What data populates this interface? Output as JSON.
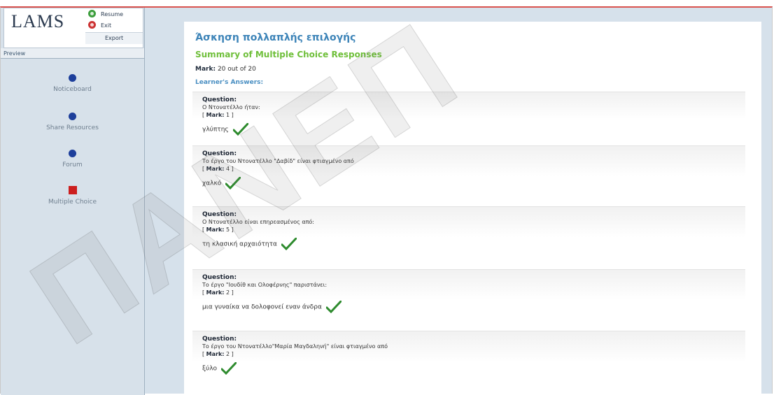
{
  "app": {
    "logo_text": "LAMS",
    "controls": {
      "resume": "Resume",
      "exit": "Exit",
      "export": "Export"
    },
    "preview_label": "Preview"
  },
  "sidebar": {
    "items": [
      {
        "label": "Noticeboard",
        "icon": "circle-icon",
        "color": "#1d3f9b"
      },
      {
        "label": "Share Resources",
        "icon": "circle-icon",
        "color": "#1d3f9b"
      },
      {
        "label": "Forum",
        "icon": "circle-icon",
        "color": "#1d3f9b"
      },
      {
        "label": "Multiple Choice",
        "icon": "square-icon",
        "color": "#cc1f1f"
      }
    ]
  },
  "main": {
    "title": "Άσκηση πολλαπλής επιλογής",
    "subtitle": "Summary of Multiple Choice Responses",
    "mark_label": "Mark:",
    "mark_value": "20 out of 20",
    "learner_heading": "Learner's Answers:",
    "question_label": "Question:",
    "mark_item_label": "Mark:",
    "questions": [
      {
        "text": "Ο Ντονατέλλο ήταν:",
        "mark": "1",
        "answer": "γλύπτης"
      },
      {
        "text": "Το έργο του Ντονατέλλο \"Δαβίδ\" είναι φτιαγμένο από",
        "mark": "4",
        "answer": "χαλκό"
      },
      {
        "text": "Ο Ντονατέλλο είναι επηρεασμένος από:",
        "mark": "5",
        "answer": "τη κλασική αρχαιότητα"
      },
      {
        "text": "Το έργο \"Ιουδίθ και Ολοφέρνης\" παριστάνει:",
        "mark": "2",
        "answer": "μια γυναίκα να δολοφονεί εναν άνδρα"
      },
      {
        "text": "Το έργο του Ντονατέλλο\"Μαρία Μαγδαληνή\" είναι φτιαγμένο από",
        "mark": "2",
        "answer": "ξύλο"
      }
    ]
  },
  "watermark_text": "ΠΑΝΕΠ",
  "colors": {
    "accent_red": "#d9534f",
    "title_blue": "#3d84b8",
    "subtitle_green": "#6fbf3a",
    "check_green": "#2e8b2e"
  }
}
